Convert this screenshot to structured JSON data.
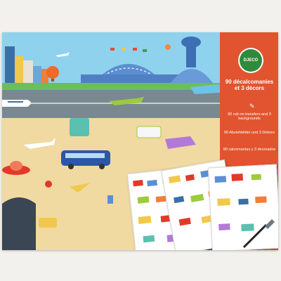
{
  "brand": {
    "name": "DJECO"
  },
  "product": {
    "title_fr": "90 décalcomanies et 3 décors",
    "desc_en": "90 rub-on transfers and 3 backgrounds",
    "desc_de": "90 Abziehbilder und 3 Dekore",
    "desc_es": "90 calcomanías y 3 decorados"
  },
  "colors": {
    "panel": "#e2542f",
    "sky": "#8fd2ee",
    "tarmac": "#7a8890",
    "ground": "#f1d9a2",
    "brand_green": "#2f8a3c"
  },
  "icons": [
    "brush-icon",
    "airplane-icon",
    "hot-air-balloon-icon",
    "bus-icon"
  ]
}
